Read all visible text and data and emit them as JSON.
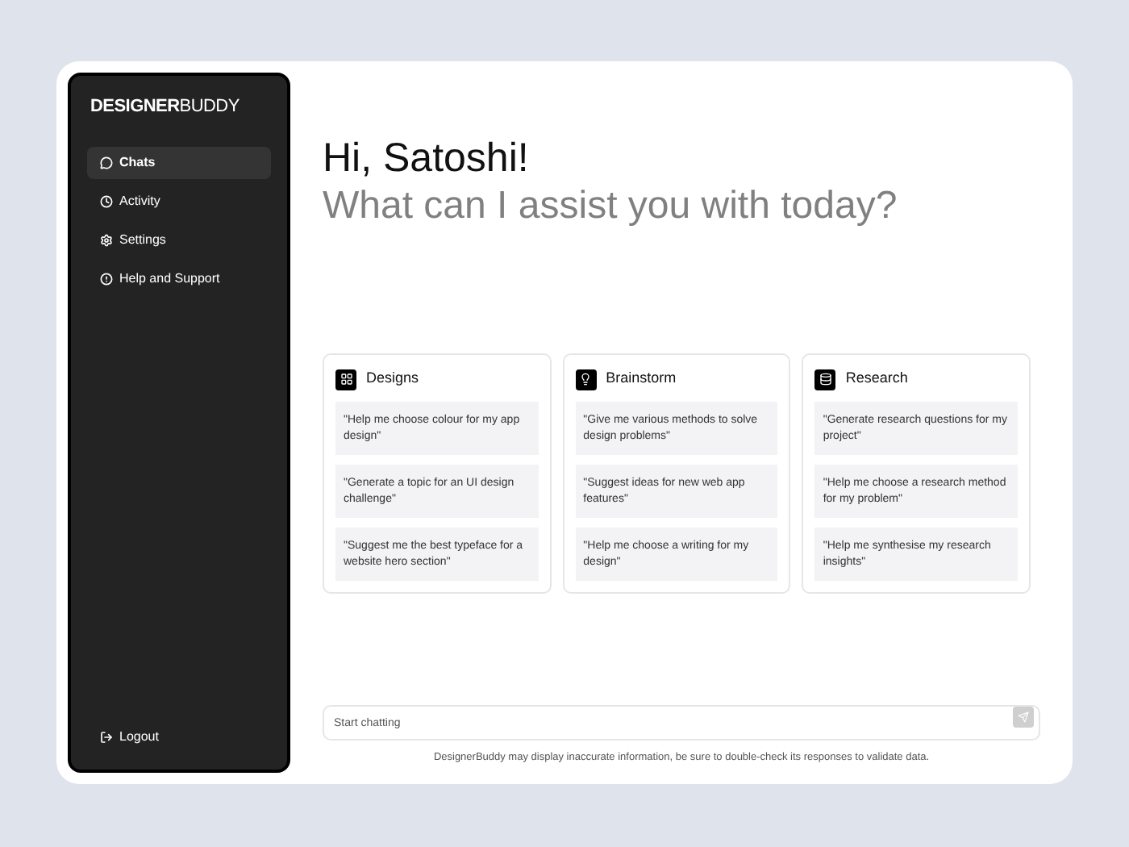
{
  "logo": "**DESIGNER**BUDDY",
  "nav": [
    {
      "label": "Chats",
      "kind": "chat",
      "selected": true
    },
    {
      "label": "Activity",
      "kind": "clock",
      "selected": false
    },
    {
      "label": "Settings",
      "kind": "gear",
      "selected": false
    },
    {
      "label": "Help and Support",
      "kind": "help",
      "selected": false
    }
  ],
  "logout": "Logout",
  "greeting": "Hi, Satoshi!",
  "subtitle": "What can I assist you with today?",
  "categories": [
    {
      "title": "Designs",
      "kind": "design",
      "prompts": [
        "\"Help me choose colour for my app design\"",
        "\"Generate a topic for an UI design challenge\"",
        "\"Suggest me the best typeface for a website hero section\""
      ]
    },
    {
      "title": "Brainstorm",
      "kind": "bulb",
      "prompts": [
        "\"Give me various methods to solve design problems\"",
        "\"Suggest ideas for new web app features\"",
        "\"Help me choose a writing for my design\""
      ]
    },
    {
      "title": "Research",
      "kind": "research",
      "prompts": [
        "\"Generate research questions for my project\"",
        "\"Help me choose a research method for my problem\"",
        "\"Help me synthesise my research insights\""
      ]
    }
  ],
  "chat": {
    "placeholder": "Start chatting"
  },
  "disclaimer": "DesignerBuddy may display inaccurate information, be sure to double-check its responses to validate data."
}
